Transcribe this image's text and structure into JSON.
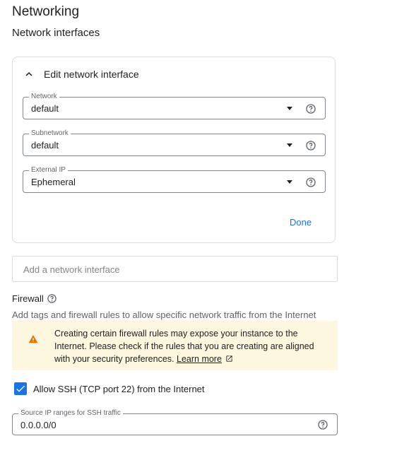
{
  "section_title": "Networking",
  "subsection_title": "Network interfaces",
  "interface_card": {
    "title": "Edit network interface",
    "fields": [
      {
        "label": "Network",
        "value": "default"
      },
      {
        "label": "Subnetwork",
        "value": "default"
      },
      {
        "label": "External IP",
        "value": "Ephemeral"
      }
    ],
    "done_label": "Done"
  },
  "add_interface_label": "Add a network interface",
  "firewall": {
    "title": "Firewall",
    "description": "Add tags and firewall rules to allow specific network traffic from the Internet",
    "warning": {
      "line1": "Creating certain firewall rules may expose your instance to the",
      "line2": "Internet. Please check if the rules that you are creating are aligned",
      "line3_prefix": "with your security preferences.",
      "link": "Learn more"
    },
    "ssh_checkbox": {
      "label": "Allow SSH (TCP port 22) from the Internet",
      "checked": true
    },
    "source_ip": {
      "label": "Source IP ranges for SSH traffic",
      "value": "0.0.0.0/0"
    }
  },
  "colors": {
    "accent": "#1a73e8",
    "warning_bg": "#fef7e0",
    "warning_icon": "#e37400"
  }
}
